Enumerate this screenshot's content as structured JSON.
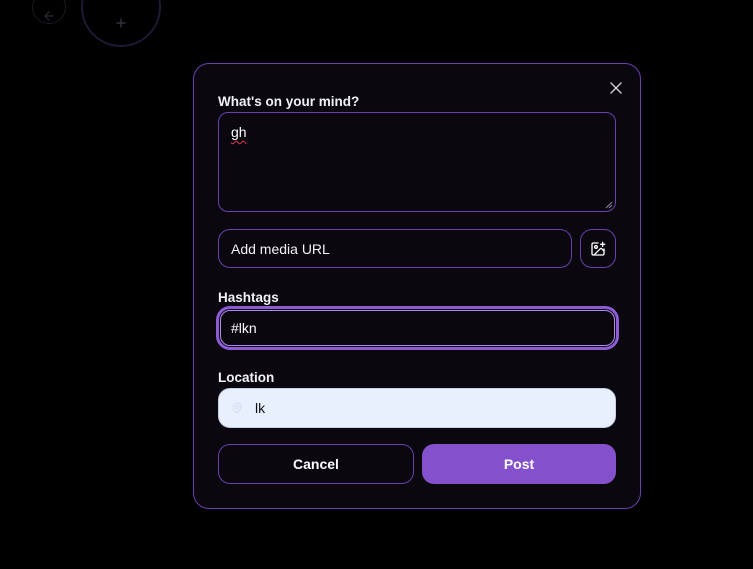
{
  "background": {
    "back_icon": "arrow-left-icon",
    "add_icon": "plus-icon"
  },
  "modal": {
    "close_icon": "close-icon",
    "content_label": "What's on your mind?",
    "content_value": "gh",
    "media_placeholder": "Add media URL",
    "media_icon": "image-plus-icon",
    "hashtags_label": "Hashtags",
    "hashtags_value": "#lkn",
    "location_label": "Location",
    "location_icon": "map-pin-icon",
    "location_value": "lk",
    "cancel_label": "Cancel",
    "post_label": "Post"
  },
  "colors": {
    "accent": "#8550cc",
    "border": "#6a3fae",
    "focus_ring": "#8b5cd6",
    "autofill_bg": "#e8effd",
    "modal_bg": "#0a070f"
  }
}
